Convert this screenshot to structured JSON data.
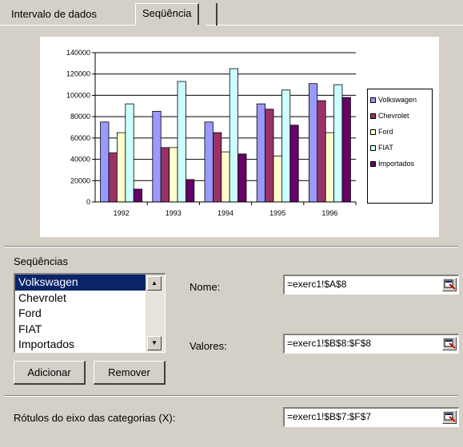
{
  "tabs": [
    {
      "label": "Intervalo de dados",
      "active": false
    },
    {
      "label": "Seqüência",
      "active": true
    }
  ],
  "colors": {
    "Volkswagen": "#9999ff",
    "Chevrolet": "#993366",
    "Ford": "#ffffcc",
    "FIAT": "#ccffff",
    "Importados": "#660066",
    "dialog_bg": "#d4d0c8",
    "selection": "#0a246a"
  },
  "chart_data": {
    "type": "bar",
    "categories": [
      "1992",
      "1993",
      "1994",
      "1995",
      "1996"
    ],
    "ylim": [
      0,
      140000
    ],
    "yticks": [
      "0",
      "20000",
      "40000",
      "60000",
      "80000",
      "100000",
      "120000",
      "140000"
    ],
    "grid": true,
    "legend_position": "right",
    "series": [
      {
        "name": "Volkswagen",
        "values": [
          75000,
          85000,
          75000,
          92000,
          111000
        ]
      },
      {
        "name": "Chevrolet",
        "values": [
          46000,
          51000,
          65000,
          87000,
          95000
        ]
      },
      {
        "name": "Ford",
        "values": [
          65000,
          51000,
          47000,
          43000,
          65000
        ]
      },
      {
        "name": "FIAT",
        "values": [
          92000,
          113000,
          125000,
          105000,
          110000
        ]
      },
      {
        "name": "Importados",
        "values": [
          12000,
          21000,
          45000,
          72000,
          98000
        ]
      }
    ]
  },
  "legend": [
    "Volkswagen",
    "Chevrolet",
    "Ford",
    "FIAT",
    "Importados"
  ],
  "sequences": {
    "heading": "Seqüências",
    "items": [
      "Volkswagen",
      "Chevrolet",
      "Ford",
      "FIAT",
      "Importados"
    ],
    "selected_index": 0
  },
  "buttons": {
    "add": "Adicionar",
    "remove": "Remover"
  },
  "fields": {
    "name_label": "Nome:",
    "name_value": "=exerc1!$A$8",
    "values_label": "Valores:",
    "values_value": "=exerc1!$B$8:$F$8",
    "categories_label": "Rótulos do eixo das categorias (X):",
    "categories_value": "=exerc1!$B$7:$F$7"
  }
}
